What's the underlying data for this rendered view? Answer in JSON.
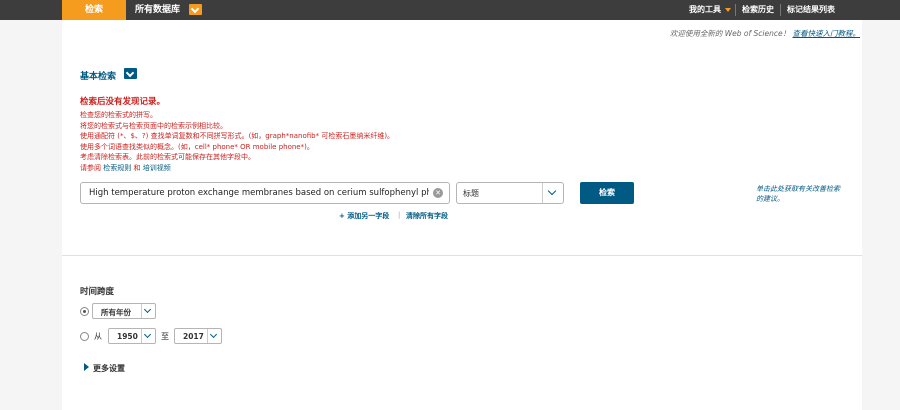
{
  "topbar": {
    "search_tab": "检索",
    "database": "所有数据库",
    "my_tools": "我的工具",
    "search_history": "检索历史",
    "marked_list": "标记结果列表"
  },
  "welcome": {
    "text": "欢迎使用全新的 Web of Science！",
    "link": "查看快速入门教程。"
  },
  "basic_search": {
    "title": "基本检索",
    "no_results": "检索后没有发现记录。",
    "tips": [
      "检查您的检索式的拼写。",
      "将您的检索式与检索页面中的检索示例相比较。",
      "使用通配符 (*、$、?) 查找单词复数和不同拼写形式。(如，graph*nanofib* 可检索石墨纳米纤维)。",
      "使用多个词语查找类似的概念。(如，cell* phone* OR mobile phone*)。",
      "考虑清除检索表。此前的检索式可能保存在其他字段中。"
    ],
    "help_prefix": "请参阅",
    "help_link1": "检索规则",
    "help_and": "和",
    "help_link2": "培训视频",
    "query": "High temperature proton exchange membranes based on cerium sulfophenyl phosphate",
    "field": "标题",
    "search_button": "检索",
    "hint": "单击此处获取有关改善检索的建议。",
    "add_field": "+ 添加另一字段",
    "separator": "|",
    "clear_all": "清除所有字段"
  },
  "timespan": {
    "title": "时间跨度",
    "all_years": "所有年份",
    "from_label": "从",
    "from_year": "1950",
    "to_label": "至",
    "to_year": "2017",
    "more_settings": "更多设置"
  }
}
